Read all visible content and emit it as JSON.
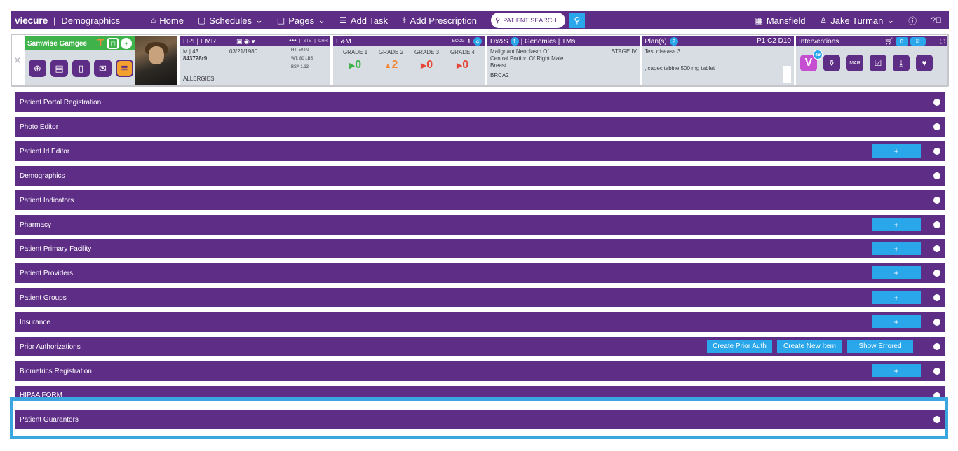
{
  "nav": {
    "brand": "viecure",
    "section": "Demographics",
    "items": [
      {
        "icon": "home-icon",
        "glyph": "⌂",
        "label": "Home"
      },
      {
        "icon": "calendar-icon",
        "glyph": "▢",
        "label": "Schedules",
        "caret": "⌄"
      },
      {
        "icon": "pages-icon",
        "glyph": "◫",
        "label": "Pages",
        "caret": "⌄"
      },
      {
        "icon": "task-list-icon",
        "glyph": "☰",
        "label": "Add Task"
      },
      {
        "icon": "prescription-icon",
        "glyph": "⚕",
        "label": "Add Prescription"
      }
    ],
    "search_placeholder": "PATIENT SEARCH",
    "location": "Mansfield",
    "user": "Jake Turman"
  },
  "patient": {
    "name": "Samwise Gamgee",
    "hpi_title": "HPI | EMR",
    "hpi_more": "•••",
    "ste": "STE",
    "chr": "CHR",
    "sex_age": "M | 43",
    "dob": "03/21/1980",
    "mrn": "843728r9",
    "height": "HT: 50 IN",
    "weight": "WT: 80 LBS",
    "bsa": "BSA 1.13",
    "allergies": "ALLERGIES",
    "em_title": "E&M",
    "ecog_label": "ECOG",
    "ecog_value": "1",
    "ecog_badge": "4",
    "grades": [
      {
        "label": "GRADE 1",
        "arrow": "▶",
        "value": "0",
        "tone": "green"
      },
      {
        "label": "GRADE 2",
        "arrow": "▲",
        "value": "2",
        "tone": "orange"
      },
      {
        "label": "GRADE 3",
        "arrow": "▶",
        "value": "0",
        "tone": "red"
      },
      {
        "label": "GRADE 4",
        "arrow": "▶",
        "value": "0",
        "tone": "red"
      }
    ],
    "dx_title_a": "Dx&S",
    "dx_badge": "1",
    "dx_title_b": "| Genomics | TMs",
    "dx_text_1": "Malignant Neoplasm Of",
    "dx_text_2": "Central Portion Of Right Male",
    "dx_text_3": "Breast",
    "dx_stage": "STAGE IV",
    "dx_gene": "BRCA2",
    "plan_title": "Plan(s)",
    "plan_badge": "2",
    "plan_cycle": "P1 C2 D10",
    "plan_line_1": "Test disease 3",
    "plan_line_2": ", capecitabine 500 mg tablet",
    "int_title": "Interventions",
    "int_cart_count": "0",
    "int_v_label": "V",
    "int_v_badge": "49"
  },
  "sections": [
    {
      "label": "Patient Portal Registration",
      "action": "none"
    },
    {
      "label": "Photo Editor",
      "action": "none"
    },
    {
      "label": "Patient Id Editor",
      "action": "plus"
    },
    {
      "label": "Demographics",
      "action": "none"
    },
    {
      "label": "Patient Indicators",
      "action": "none"
    },
    {
      "label": "Pharmacy",
      "action": "plus"
    },
    {
      "label": "Patient Primary Facility",
      "action": "plus"
    },
    {
      "label": "Patient Providers",
      "action": "plus"
    },
    {
      "label": "Patient Groups",
      "action": "plus"
    },
    {
      "label": "Insurance",
      "action": "plus"
    },
    {
      "label": "Prior Authorizations",
      "action": "buttons",
      "buttons": [
        "Create Prior Auth",
        "Create New Item",
        "Show Errored"
      ]
    },
    {
      "label": "Biometrics Registration",
      "action": "plus"
    },
    {
      "label": "HIPAA FORM",
      "action": "none"
    },
    {
      "label": "Patient Guarantors",
      "action": "none"
    }
  ],
  "plus_label": "+",
  "colors": {
    "primary": "#5e2d86",
    "accent": "#2aa6ea",
    "green": "#3fb34a",
    "highlight": "#3aa6e0"
  }
}
